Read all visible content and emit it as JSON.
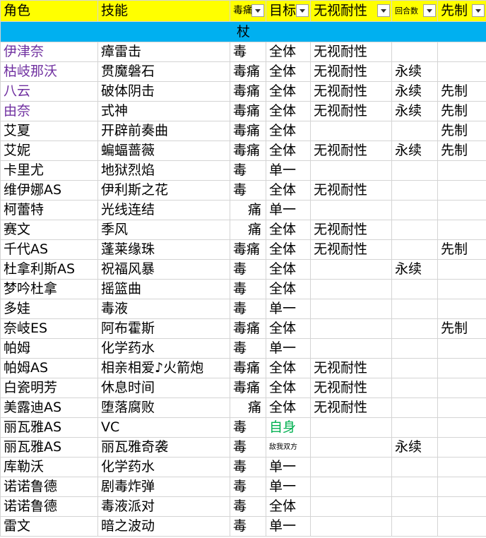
{
  "headers": [
    "角色",
    "技能",
    "毒痛",
    "目标",
    "无视耐性",
    "回合数",
    "先制"
  ],
  "section": "杖",
  "colors": {
    "header_bg": "#ffff00",
    "section_bg": "#00b0f0",
    "purple_text": "#7030a0",
    "green_text": "#00b050"
  },
  "rows": [
    {
      "role": "伊津奈",
      "skill": "瘴雷击",
      "poison": "毒",
      "target": "全体",
      "ignore": "无视耐性",
      "turns": "",
      "first": ""
    },
    {
      "role": "枯岐那沃",
      "skill": "贯魔磐石",
      "poison": "毒痛",
      "target": "全体",
      "ignore": "无视耐性",
      "turns": "永续",
      "first": ""
    },
    {
      "role": "八云",
      "skill": "破体阴击",
      "poison": "毒痛",
      "target": "全体",
      "ignore": "无视耐性",
      "turns": "永续",
      "first": "先制"
    },
    {
      "role": "由奈",
      "skill": "式神",
      "poison": "毒痛",
      "target": "全体",
      "ignore": "无视耐性",
      "turns": "永续",
      "first": "先制"
    },
    {
      "role": "艾夏",
      "skill": "开辟前奏曲",
      "poison": "毒痛",
      "target": "全体",
      "ignore": "",
      "turns": "",
      "first": "先制"
    },
    {
      "role": "艾妮",
      "skill": "蝙蝠蔷薇",
      "poison": "毒痛",
      "target": "全体",
      "ignore": "无视耐性",
      "turns": "永续",
      "first": "先制"
    },
    {
      "role": "卡里尤",
      "skill": "地狱烈焰",
      "poison": "毒",
      "target": "单一",
      "ignore": "",
      "turns": "",
      "first": ""
    },
    {
      "role": "维伊娜AS",
      "skill": "伊利斯之花",
      "poison": "毒",
      "target": "全体",
      "ignore": "无视耐性",
      "turns": "",
      "first": ""
    },
    {
      "role": "柯蕾特",
      "skill": "光线连结",
      "poison": "痛",
      "target": "单一",
      "ignore": "",
      "turns": "",
      "first": ""
    },
    {
      "role": "赛文",
      "skill": "季风",
      "poison": "痛",
      "target": "全体",
      "ignore": "无视耐性",
      "turns": "",
      "first": ""
    },
    {
      "role": "千代AS",
      "skill": "蓬莱缘珠",
      "poison": "毒痛",
      "target": "全体",
      "ignore": "无视耐性",
      "turns": "",
      "first": "先制"
    },
    {
      "role": "杜拿利斯AS",
      "skill": "祝福风暴",
      "poison": "毒",
      "target": "全体",
      "ignore": "",
      "turns": "永续",
      "first": ""
    },
    {
      "role": "梦吟杜拿",
      "skill": "摇篮曲",
      "poison": "毒",
      "target": "全体",
      "ignore": "",
      "turns": "",
      "first": ""
    },
    {
      "role": "多娃",
      "skill": "毒液",
      "poison": "毒",
      "target": "单一",
      "ignore": "",
      "turns": "",
      "first": ""
    },
    {
      "role": "奈岐ES",
      "skill": "阿布霍斯",
      "poison": "毒痛",
      "target": "全体",
      "ignore": "",
      "turns": "",
      "first": "先制"
    },
    {
      "role": "帕姆",
      "skill": "化学药水",
      "poison": "毒",
      "target": "单一",
      "ignore": "",
      "turns": "",
      "first": ""
    },
    {
      "role": "帕姆AS",
      "skill": "相亲相爱♪火箭炮",
      "poison": "毒痛",
      "target": "全体",
      "ignore": "无视耐性",
      "turns": "",
      "first": ""
    },
    {
      "role": "白瓷明芳",
      "skill": "休息时间",
      "poison": "毒痛",
      "target": "全体",
      "ignore": "无视耐性",
      "turns": "",
      "first": ""
    },
    {
      "role": "美露迪AS",
      "skill": "堕落腐败",
      "poison": "痛",
      "target": "全体",
      "ignore": "无视耐性",
      "turns": "",
      "first": ""
    },
    {
      "role": "丽瓦雅AS",
      "skill": "VC",
      "poison": "毒",
      "target": "自身",
      "ignore": "",
      "turns": "",
      "first": ""
    },
    {
      "role": "丽瓦雅AS",
      "skill": "丽瓦雅奇袭",
      "poison": "毒",
      "target": "敌我双方",
      "ignore": "",
      "turns": "永续",
      "first": ""
    },
    {
      "role": "库勒沃",
      "skill": "化学药水",
      "poison": "毒",
      "target": "单一",
      "ignore": "",
      "turns": "",
      "first": ""
    },
    {
      "role": "诺诺鲁德",
      "skill": "剧毒炸弹",
      "poison": "毒",
      "target": "单一",
      "ignore": "",
      "turns": "",
      "first": ""
    },
    {
      "role": "诺诺鲁德",
      "skill": "毒液派对",
      "poison": "毒",
      "target": "全体",
      "ignore": "",
      "turns": "",
      "first": ""
    },
    {
      "role": "雷文",
      "skill": "暗之波动",
      "poison": "毒",
      "target": "单一",
      "ignore": "",
      "turns": "",
      "first": ""
    }
  ]
}
